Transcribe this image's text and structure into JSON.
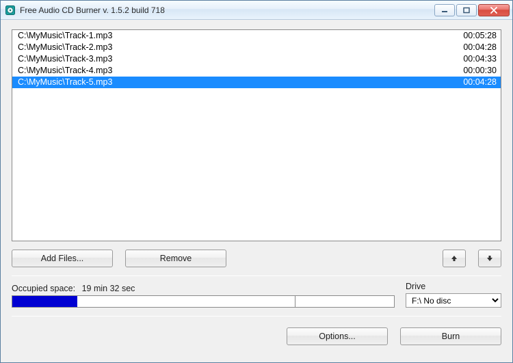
{
  "window": {
    "title": "Free Audio CD Burner  v. 1.5.2 build 718"
  },
  "tracks": [
    {
      "path": "C:\\MyMusic\\Track-1.mp3",
      "duration": "00:05:28",
      "selected": false
    },
    {
      "path": "C:\\MyMusic\\Track-2.mp3",
      "duration": "00:04:28",
      "selected": false
    },
    {
      "path": "C:\\MyMusic\\Track-3.mp3",
      "duration": "00:04:33",
      "selected": false
    },
    {
      "path": "C:\\MyMusic\\Track-4.mp3",
      "duration": "00:00:30",
      "selected": false
    },
    {
      "path": "C:\\MyMusic\\Track-5.mp3",
      "duration": "00:04:28",
      "selected": true
    }
  ],
  "buttons": {
    "add_files": "Add Files...",
    "remove": "Remove",
    "options": "Options...",
    "burn": "Burn"
  },
  "space": {
    "label": "Occupied space:",
    "value": "19 min 32 sec",
    "fill_percent": 17,
    "target_percent": 74
  },
  "drive": {
    "label": "Drive",
    "selected": "F:\\ No disc"
  }
}
